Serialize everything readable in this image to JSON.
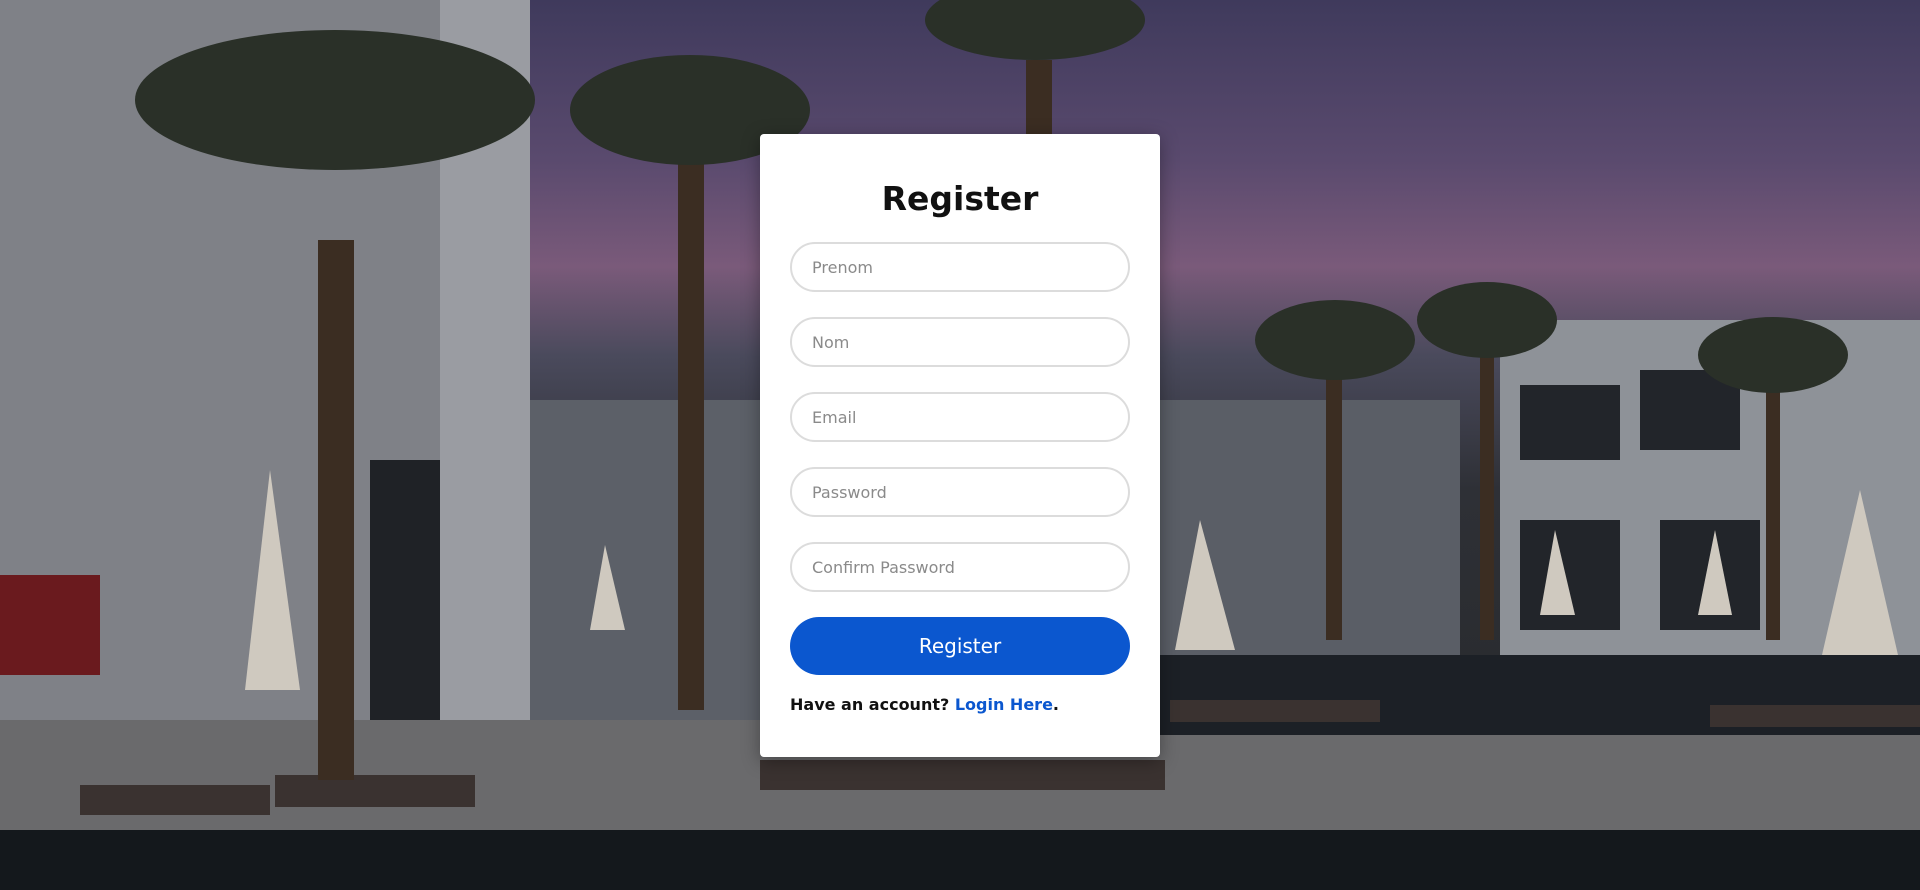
{
  "register_form": {
    "title": "Register",
    "fields": {
      "prenom_placeholder": "Prenom",
      "nom_placeholder": "Nom",
      "email_placeholder": "Email",
      "password_placeholder": "Password",
      "confirm_password_placeholder": "Confirm Password"
    },
    "submit_label": "Register",
    "footer": {
      "prompt": "Have an account?",
      "link_label": "Login Here",
      "suffix": "."
    }
  },
  "colors": {
    "accent": "#0b57cf",
    "card_background": "#ffffff"
  }
}
